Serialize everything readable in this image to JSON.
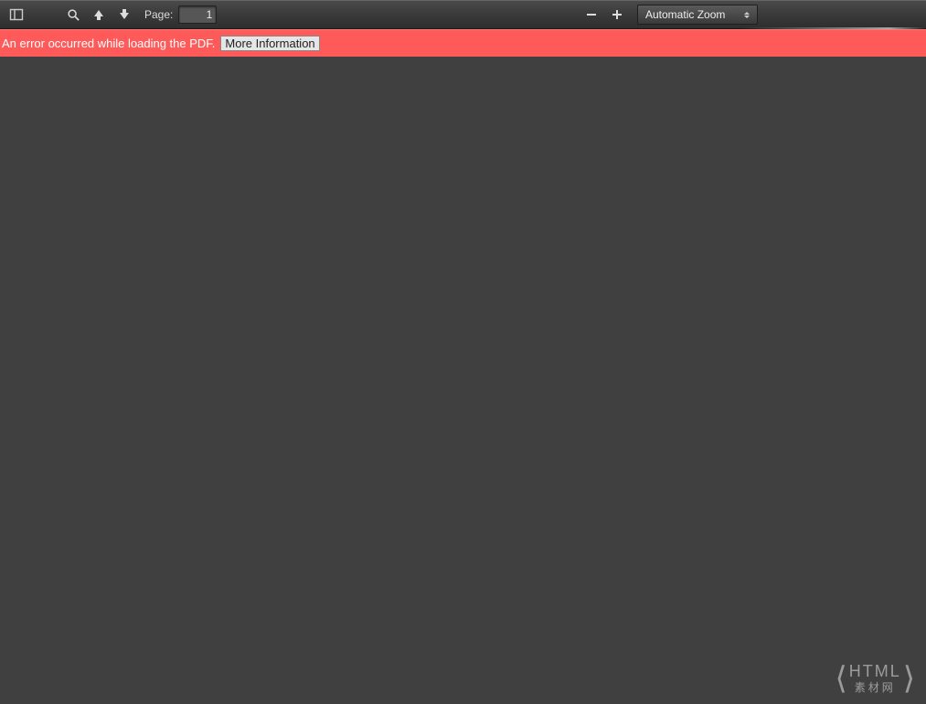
{
  "toolbar": {
    "page_label": "Page:",
    "page_value": "1",
    "zoom_selected": "Automatic Zoom"
  },
  "error": {
    "message": "An error occurred while loading the PDF.",
    "more_info_label": "More Information"
  },
  "watermark": {
    "line1": "HTML",
    "line2": "素材网"
  }
}
